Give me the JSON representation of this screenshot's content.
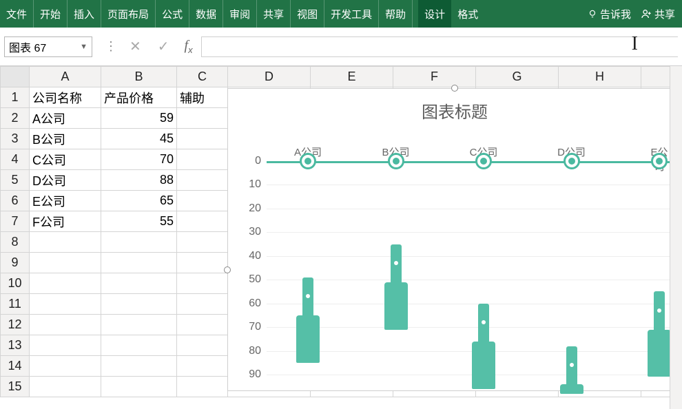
{
  "ribbon": {
    "tabs": [
      "文件",
      "开始",
      "插入",
      "页面布局",
      "公式",
      "数据",
      "审阅",
      "共享",
      "视图",
      "开发工具",
      "帮助"
    ],
    "context_tabs": [
      "设计",
      "格式"
    ],
    "tellme": "告诉我",
    "share": "共享"
  },
  "namebox": {
    "value": "图表 67"
  },
  "formula": {
    "value": ""
  },
  "columns": [
    "A",
    "B",
    "C",
    "D",
    "E",
    "F",
    "G",
    "H"
  ],
  "rows": [
    "1",
    "2",
    "3",
    "4",
    "5",
    "6",
    "7",
    "8",
    "9",
    "10",
    "11",
    "12",
    "13",
    "14",
    "15"
  ],
  "cells": {
    "A1": "公司名称",
    "B1": "产品价格",
    "C1": "辅助",
    "A2": "A公司",
    "B2": "59",
    "A3": "B公司",
    "B3": "45",
    "A4": "C公司",
    "B4": "70",
    "A5": "D公司",
    "B5": "88",
    "A6": "E公司",
    "B6": "65",
    "A7": "F公司",
    "B7": "55"
  },
  "chart_data": {
    "type": "bar",
    "title": "图表标题",
    "categories": [
      "A公司",
      "B公司",
      "C公司",
      "D公司",
      "E公司"
    ],
    "series": [
      {
        "name": "辅助",
        "values": [
          0,
          0,
          0,
          0,
          0
        ]
      },
      {
        "name": "产品价格",
        "values": [
          59,
          45,
          70,
          88,
          65
        ]
      }
    ],
    "xlabel": "",
    "ylabel": "",
    "ylim": [
      0,
      90
    ],
    "yticks": [
      0,
      10,
      20,
      30,
      40,
      50,
      60,
      70,
      80,
      90
    ],
    "y_reversed": true,
    "note": "bottles drawn with neck≈20u above value, body≈20u below; top at value-10"
  },
  "accent": "#4ab9a0"
}
